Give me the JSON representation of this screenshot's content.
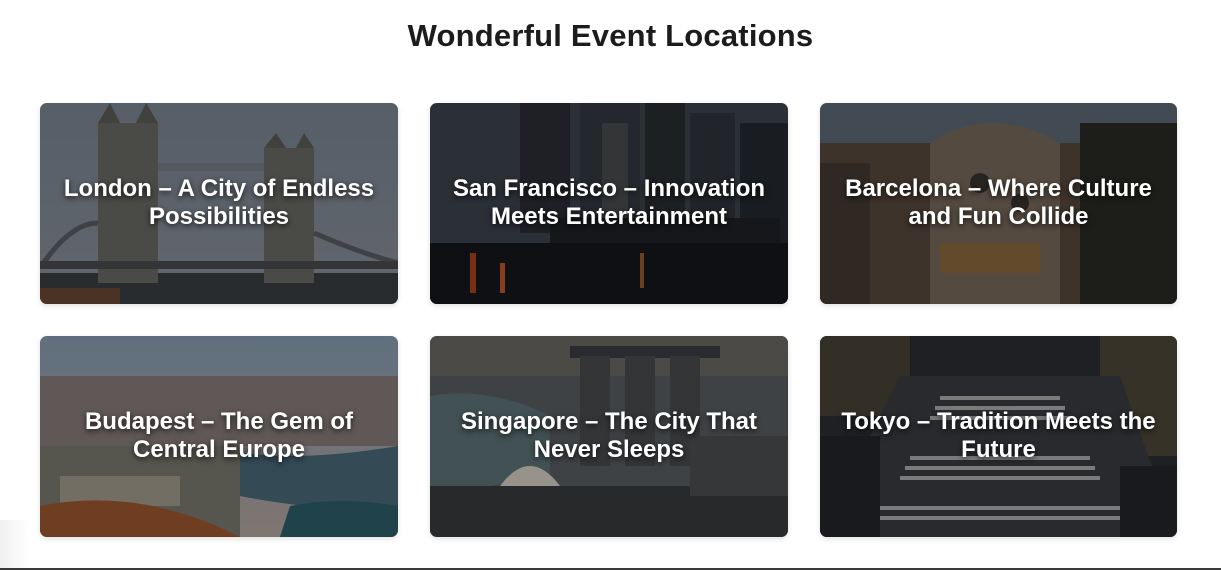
{
  "section": {
    "title": "Wonderful Event Locations"
  },
  "locations": [
    {
      "title": "London – A City of Endless Possibilities",
      "image": "tower-bridge-photo"
    },
    {
      "title": "San Francisco – Innovation Meets Entertainment",
      "image": "ferry-building-photo"
    },
    {
      "title": "Barcelona – Where Culture and Fun Collide",
      "image": "casa-batllo-photo"
    },
    {
      "title": "Budapest – The Gem of Central Europe",
      "image": "budapest-aerial-photo"
    },
    {
      "title": "Singapore – The City That Never Sleeps",
      "image": "marina-bay-photo"
    },
    {
      "title": "Tokyo – Tradition Meets the Future",
      "image": "shibuya-crossing-photo"
    }
  ],
  "colors": {
    "heading": "#1c1c1c",
    "card_text": "#ffffff"
  }
}
